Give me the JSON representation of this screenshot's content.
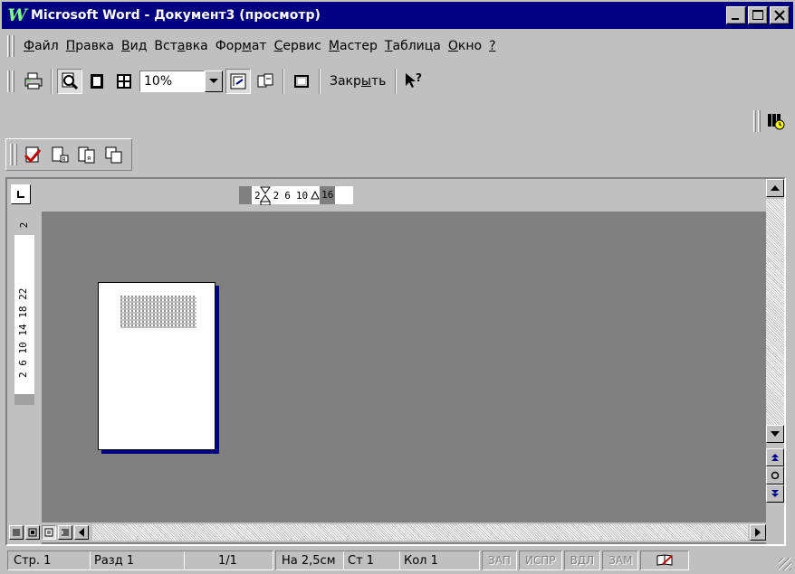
{
  "window": {
    "title": "Microsoft Word - Документ3 (просмотр)",
    "logo_letter": "W"
  },
  "menu": {
    "items": [
      {
        "label": "Файл",
        "key": "Ф",
        "rest": "айл"
      },
      {
        "label": "Правка",
        "key": "П",
        "rest": "равка"
      },
      {
        "label": "Вид",
        "key": "В",
        "rest": "ид"
      },
      {
        "label": "Вставка",
        "pre": "Вст",
        "key": "а",
        "rest": "вка"
      },
      {
        "label": "Формат",
        "pre": "Фор",
        "key": "м",
        "rest": "ат"
      },
      {
        "label": "Сервис",
        "key": "С",
        "rest": "ервис"
      },
      {
        "label": "Мастер",
        "key": "М",
        "rest": "астер"
      },
      {
        "label": "Таблица",
        "key": "Т",
        "rest": "аблица"
      },
      {
        "label": "Окно",
        "key": "О",
        "rest": "кно"
      },
      {
        "label": "?",
        "key": "?",
        "rest": ""
      }
    ]
  },
  "toolbar": {
    "zoom_value": "10%",
    "close_label": "Закрыть",
    "close_pre": "Закр",
    "close_key": "ы",
    "close_rest": "ть"
  },
  "ruler": {
    "h_marks": [
      "2",
      "2",
      "6",
      "10",
      "16"
    ],
    "v_marks": "2  6  10  14  18  22",
    "v_top": "2"
  },
  "status": {
    "page": "Стр. 1",
    "section": "Разд 1",
    "pages": "1/1",
    "position": "На 2,5см",
    "line": "Ст 1",
    "column": "Кол 1",
    "rec": "ЗАП",
    "trk": "ИСПР",
    "ext": "ВДЛ",
    "ovr": "ЗАМ"
  }
}
